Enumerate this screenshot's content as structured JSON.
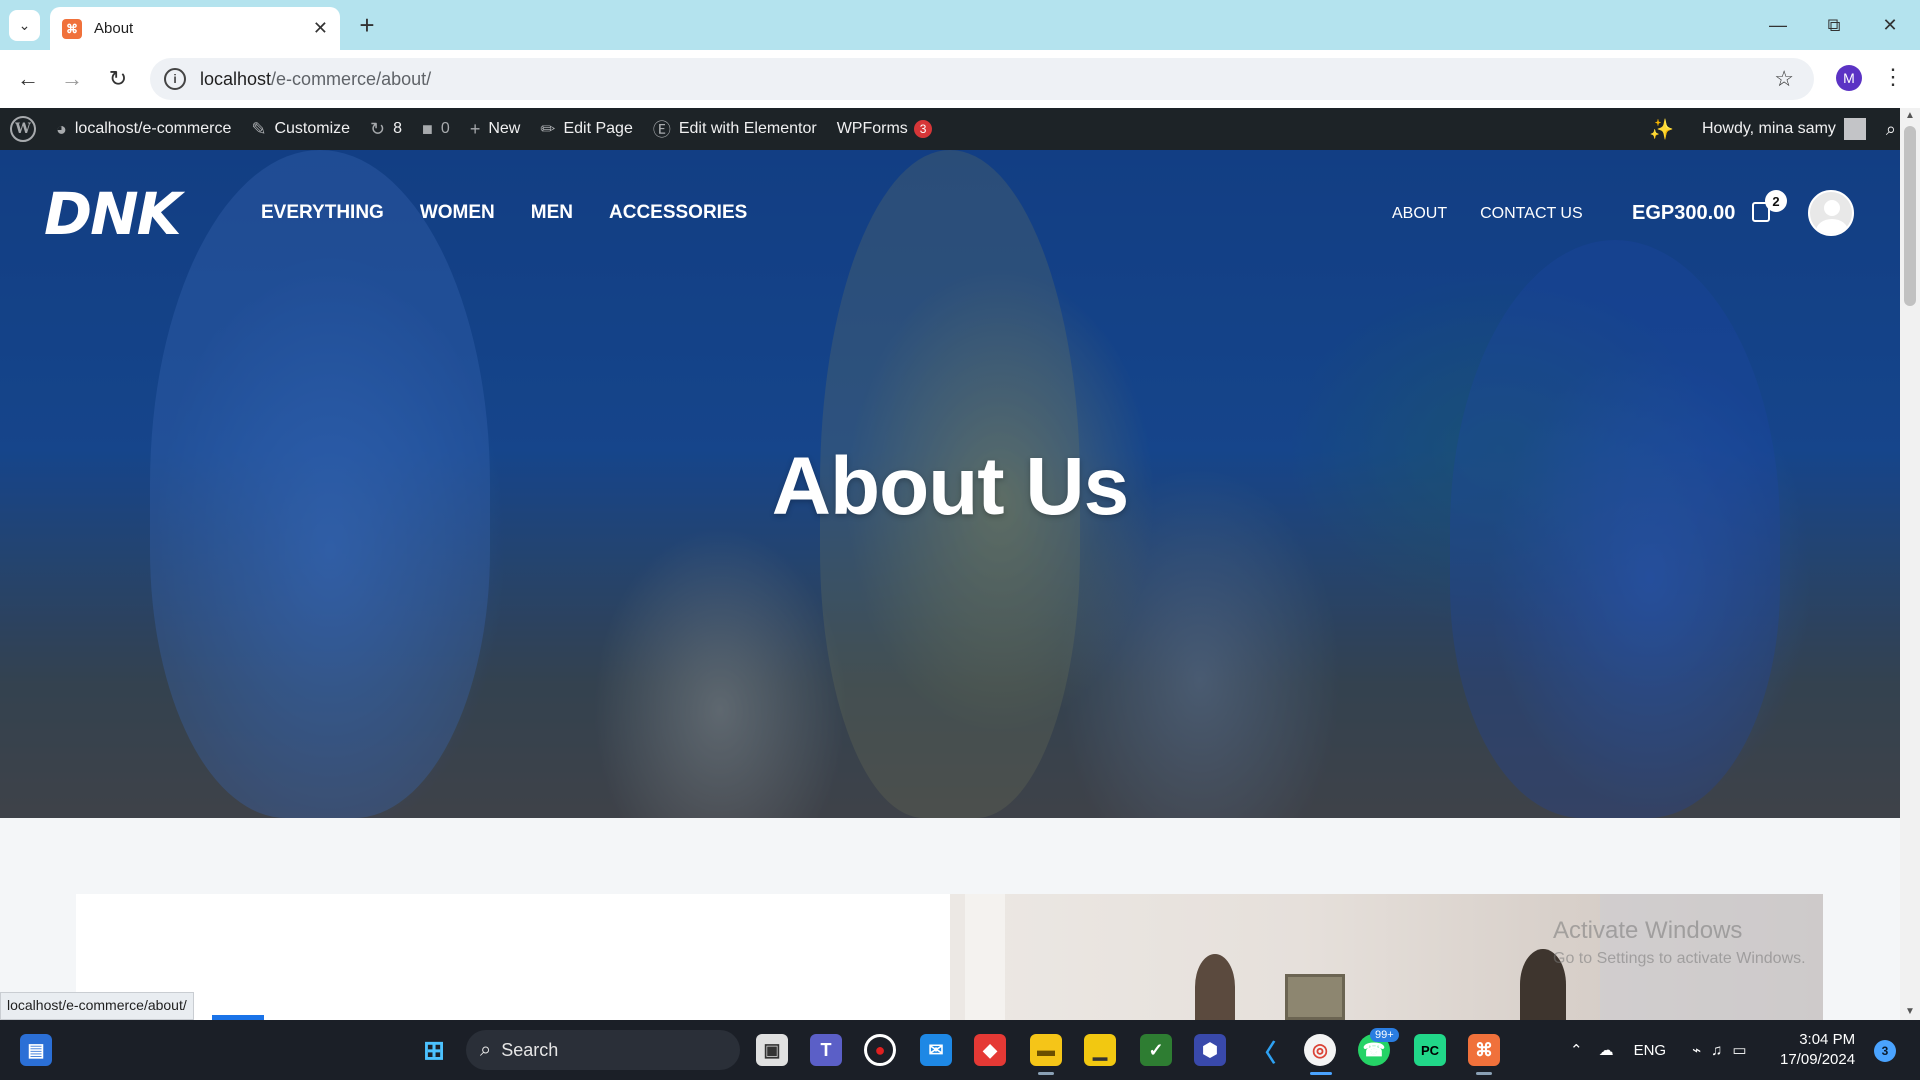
{
  "browser": {
    "tab_title": "About",
    "url_host": "localhost",
    "url_path": "/e-commerce/about/",
    "profile_initial": "M"
  },
  "wp_admin_bar": {
    "site": "localhost/e-commerce",
    "customize": "Customize",
    "updates_count": "8",
    "comments_count": "0",
    "new": "New",
    "edit_page": "Edit Page",
    "edit_elementor": "Edit with Elementor",
    "wpforms": "WPForms",
    "wpforms_badge": "3",
    "howdy": "Howdy, mina samy"
  },
  "site_header": {
    "logo": "DNK",
    "main_nav": [
      "EVERYTHING",
      "WOMEN",
      "MEN",
      "ACCESSORIES"
    ],
    "right_nav": [
      "ABOUT",
      "CONTACT US"
    ],
    "cart_total": "EGP300.00",
    "cart_count": "2"
  },
  "hero": {
    "title": "About Us"
  },
  "watermark": {
    "line1": "Activate Windows",
    "line2": "Go to Settings to activate Windows."
  },
  "status_bar": {
    "url": "localhost/e-commerce/about/"
  },
  "taskbar": {
    "search_label": "Search",
    "whatsapp_badge": "99+",
    "language": "ENG",
    "time": "3:04 PM",
    "date": "17/09/2024",
    "notification_count": "3"
  },
  "colors": {
    "tabstrip": "#b4e3ee",
    "wp_bar": "#1d2327",
    "hero_blue": "#16448a",
    "taskbar": "#1b1f27",
    "badge_red": "#d63638"
  }
}
